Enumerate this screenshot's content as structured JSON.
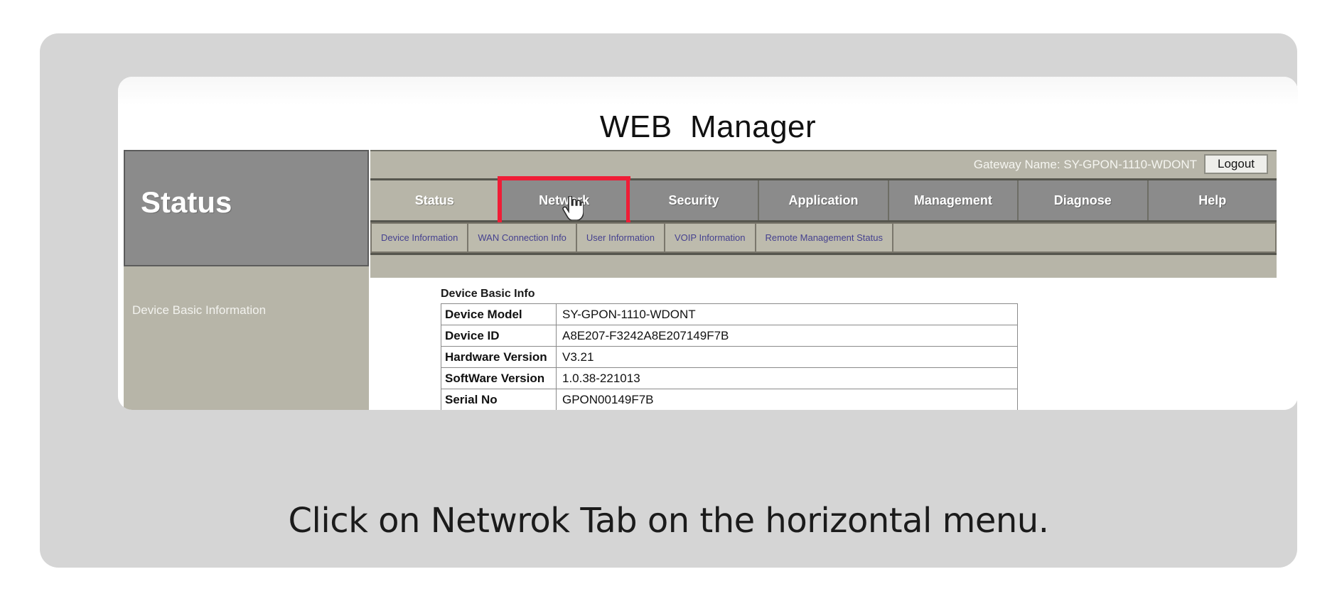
{
  "page": {
    "title": "WEB  Manager",
    "caption": "Click on Netwrok Tab on the horizontal menu."
  },
  "sidebar": {
    "heading": "Status",
    "items": [
      {
        "label": "Device Basic Information"
      }
    ]
  },
  "header": {
    "gateway_name": "Gateway Name: SY-GPON-1110-WDONT",
    "logout_label": "Logout"
  },
  "main_tabs": [
    {
      "label": "Status",
      "active": true,
      "highlighted": false
    },
    {
      "label": "Network",
      "active": false,
      "highlighted": true
    },
    {
      "label": "Security",
      "active": false,
      "highlighted": false
    },
    {
      "label": "Application",
      "active": false,
      "highlighted": false
    },
    {
      "label": "Management",
      "active": false,
      "highlighted": false
    },
    {
      "label": "Diagnose",
      "active": false,
      "highlighted": false
    },
    {
      "label": "Help",
      "active": false,
      "highlighted": false
    }
  ],
  "submenu": [
    {
      "label": "Device Information"
    },
    {
      "label": "WAN Connection Info"
    },
    {
      "label": "User Information"
    },
    {
      "label": "VOIP Information"
    },
    {
      "label": "Remote Management Status"
    }
  ],
  "content": {
    "table_heading": "Device Basic Info",
    "rows": [
      {
        "label": "Device Model",
        "value": "SY-GPON-1110-WDONT"
      },
      {
        "label": "Device ID",
        "value": "A8E207-F3242A8E207149F7B"
      },
      {
        "label": "Hardware Version",
        "value": "V3.21"
      },
      {
        "label": "SoftWare Version",
        "value": "1.0.38-221013"
      },
      {
        "label": "Serial No",
        "value": "GPON00149F7B"
      }
    ]
  },
  "colors": {
    "outer_panel": "#d5d5d5",
    "tan": "#b7b5a8",
    "gray": "#8b8b8b",
    "highlight_red": "#ef1d36",
    "link_blue": "#45418f"
  },
  "icons": {
    "cursor": "hand-pointer-cursor"
  }
}
